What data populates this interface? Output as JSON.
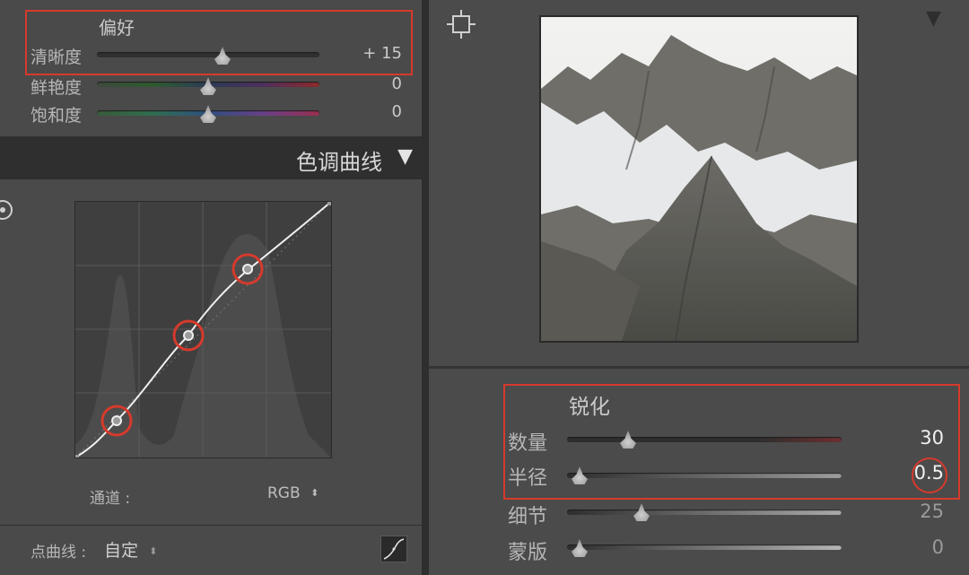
{
  "presence": {
    "title": "偏好",
    "sliders": [
      {
        "label": "清晰度",
        "value": "+ 15",
        "position": 0.55
      },
      {
        "label": "鲜艳度",
        "value": "0",
        "position": 0.5
      },
      {
        "label": "饱和度",
        "value": "0",
        "position": 0.5
      }
    ]
  },
  "tone_curve": {
    "title": "色调曲线",
    "channel_label": "通道 :",
    "channel_value": "RGB",
    "point_curve_label": "点曲线 :",
    "point_curve_value": "自定"
  },
  "sharpening": {
    "title": "锐化",
    "sliders": [
      {
        "label": "数量",
        "value": "30",
        "position": 0.22
      },
      {
        "label": "半径",
        "value": "0.5",
        "position": 0.0
      },
      {
        "label": "细节",
        "value": "25",
        "position": 0.27
      },
      {
        "label": "蒙版",
        "value": "0",
        "position": 0.0
      }
    ]
  },
  "colors": {
    "highlight": "#d63a2c",
    "panel_bg": "#4a4a4a",
    "header_bg": "#2f2f2f"
  },
  "icons": {
    "target": "target-adjust-icon",
    "crosshair": "crosshair-icon",
    "collapse": "triangle-down-icon",
    "updown": "up-down-arrows-icon",
    "curve": "curve-toggle-icon"
  }
}
